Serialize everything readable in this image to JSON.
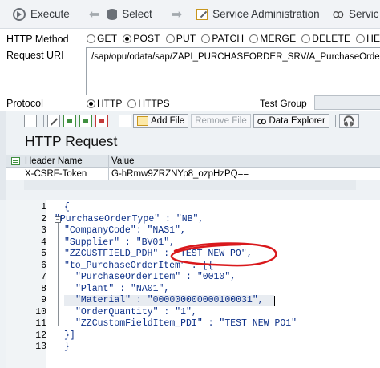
{
  "toolbar": {
    "execute_label": "Execute",
    "select_label": "Select",
    "service_admin_label": "Service Administration",
    "service_label": "Servic"
  },
  "form": {
    "http_method_label": "HTTP Method",
    "methods": [
      "GET",
      "POST",
      "PUT",
      "PATCH",
      "MERGE",
      "DELETE",
      "HEAD"
    ],
    "selected_method": "POST",
    "request_uri_label": "Request URI",
    "request_uri_value": "/sap/opu/odata/sap/ZAPI_PURCHASEORDER_SRV/A_PurchaseOrder",
    "protocol_label": "Protocol",
    "protocols": [
      "HTTP",
      "HTTPS"
    ],
    "selected_protocol": "HTTP",
    "test_group_label": "Test Group"
  },
  "buttonbar": {
    "add_file_label": "Add File",
    "remove_file_label": "Remove File",
    "data_explorer_label": "Data Explorer"
  },
  "request": {
    "title": "HTTP Request",
    "header_columns": [
      "Header Name",
      "Value"
    ],
    "headers": [
      {
        "name": "X-CSRF-Token",
        "value": "G-hRmw9ZRZNYp8_ozpHzPQ=="
      }
    ]
  },
  "editor": {
    "lines": [
      {
        "num": "1",
        "text": "{"
      },
      {
        "num": "2",
        "text": "\"PurchaseOrderType\" : \"NB\","
      },
      {
        "num": "3",
        "text": "\"CompanyCode\": \"NAS1\","
      },
      {
        "num": "4",
        "text": "\"Supplier\" : \"BV01\","
      },
      {
        "num": "5",
        "text": "\"ZZCUSTFIELD_PDH\" : \"TEST NEW PO\","
      },
      {
        "num": "6",
        "text": "\"to_PurchaseOrderItem\" : [{"
      },
      {
        "num": "7",
        "text": "\"PurchaseOrderItem\" : \"0010\","
      },
      {
        "num": "8",
        "text": "\"Plant\" : \"NA01\","
      },
      {
        "num": "9",
        "text": "\"Material\" : \"000000000000100031\","
      },
      {
        "num": "10",
        "text": "\"OrderQuantity\" : \"1\","
      },
      {
        "num": "11",
        "text": "\"ZZCustomFieldItem_PDI\" : \"TEST NEW PO1\""
      },
      {
        "num": "12",
        "text": "}]"
      },
      {
        "num": "13",
        "text": "}"
      }
    ],
    "highlighted_line": "9",
    "annotated_line": "5"
  },
  "colors": {
    "code_text": "#0b2f88",
    "annotation": "#d9181c",
    "toolbar_bg": "#f1f3f6"
  }
}
